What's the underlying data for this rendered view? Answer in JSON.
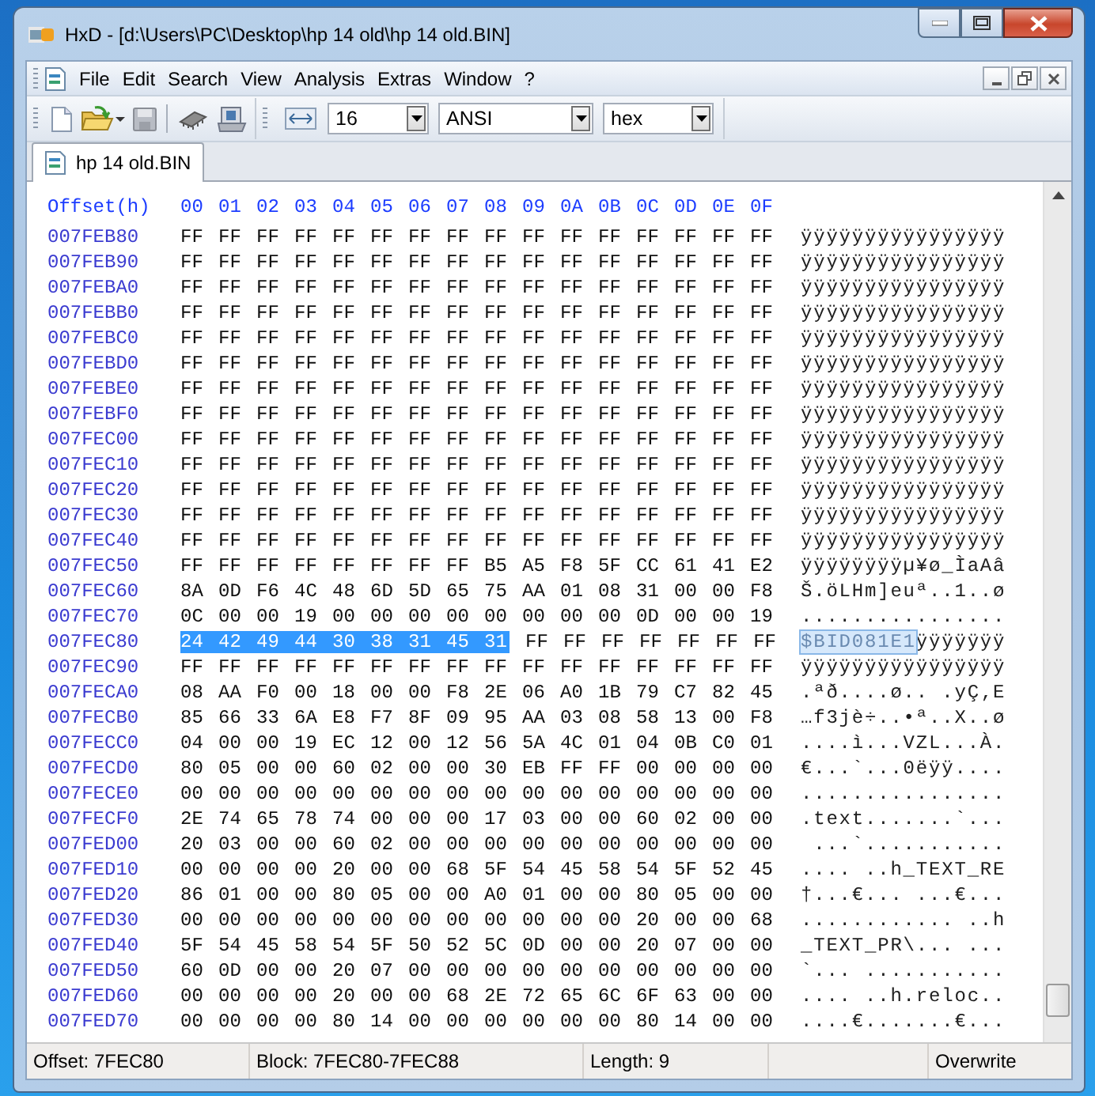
{
  "window": {
    "title": "HxD - [d:\\Users\\PC\\Desktop\\hp 14 old\\hp 14 old.BIN]"
  },
  "menu": [
    "File",
    "Edit",
    "Search",
    "View",
    "Analysis",
    "Extras",
    "Window",
    "?"
  ],
  "toolbar": {
    "bytes_per_row": "16",
    "charset": "ANSI",
    "offset_base": "hex"
  },
  "tabs": [
    {
      "label": "hp 14 old.BIN",
      "selected": true
    }
  ],
  "editor": {
    "offset_header": "Offset(h)",
    "column_headers": [
      "00",
      "01",
      "02",
      "03",
      "04",
      "05",
      "06",
      "07",
      "08",
      "09",
      "0A",
      "0B",
      "0C",
      "0D",
      "0E",
      "0F"
    ],
    "rows": [
      {
        "offset": "007FEB80",
        "hex": "FF FF FF FF FF FF FF FF FF FF FF FF FF FF FF FF",
        "text": "ÿÿÿÿÿÿÿÿÿÿÿÿÿÿÿÿ"
      },
      {
        "offset": "007FEB90",
        "hex": "FF FF FF FF FF FF FF FF FF FF FF FF FF FF FF FF",
        "text": "ÿÿÿÿÿÿÿÿÿÿÿÿÿÿÿÿ"
      },
      {
        "offset": "007FEBA0",
        "hex": "FF FF FF FF FF FF FF FF FF FF FF FF FF FF FF FF",
        "text": "ÿÿÿÿÿÿÿÿÿÿÿÿÿÿÿÿ"
      },
      {
        "offset": "007FEBB0",
        "hex": "FF FF FF FF FF FF FF FF FF FF FF FF FF FF FF FF",
        "text": "ÿÿÿÿÿÿÿÿÿÿÿÿÿÿÿÿ"
      },
      {
        "offset": "007FEBC0",
        "hex": "FF FF FF FF FF FF FF FF FF FF FF FF FF FF FF FF",
        "text": "ÿÿÿÿÿÿÿÿÿÿÿÿÿÿÿÿ"
      },
      {
        "offset": "007FEBD0",
        "hex": "FF FF FF FF FF FF FF FF FF FF FF FF FF FF FF FF",
        "text": "ÿÿÿÿÿÿÿÿÿÿÿÿÿÿÿÿ"
      },
      {
        "offset": "007FEBE0",
        "hex": "FF FF FF FF FF FF FF FF FF FF FF FF FF FF FF FF",
        "text": "ÿÿÿÿÿÿÿÿÿÿÿÿÿÿÿÿ"
      },
      {
        "offset": "007FEBF0",
        "hex": "FF FF FF FF FF FF FF FF FF FF FF FF FF FF FF FF",
        "text": "ÿÿÿÿÿÿÿÿÿÿÿÿÿÿÿÿ"
      },
      {
        "offset": "007FEC00",
        "hex": "FF FF FF FF FF FF FF FF FF FF FF FF FF FF FF FF",
        "text": "ÿÿÿÿÿÿÿÿÿÿÿÿÿÿÿÿ"
      },
      {
        "offset": "007FEC10",
        "hex": "FF FF FF FF FF FF FF FF FF FF FF FF FF FF FF FF",
        "text": "ÿÿÿÿÿÿÿÿÿÿÿÿÿÿÿÿ"
      },
      {
        "offset": "007FEC20",
        "hex": "FF FF FF FF FF FF FF FF FF FF FF FF FF FF FF FF",
        "text": "ÿÿÿÿÿÿÿÿÿÿÿÿÿÿÿÿ"
      },
      {
        "offset": "007FEC30",
        "hex": "FF FF FF FF FF FF FF FF FF FF FF FF FF FF FF FF",
        "text": "ÿÿÿÿÿÿÿÿÿÿÿÿÿÿÿÿ"
      },
      {
        "offset": "007FEC40",
        "hex": "FF FF FF FF FF FF FF FF FF FF FF FF FF FF FF FF",
        "text": "ÿÿÿÿÿÿÿÿÿÿÿÿÿÿÿÿ"
      },
      {
        "offset": "007FEC50",
        "hex": "FF FF FF FF FF FF FF FF B5 A5 F8 5F CC 61 41 E2",
        "text": "ÿÿÿÿÿÿÿÿµ¥ø_ÌaAâ"
      },
      {
        "offset": "007FEC60",
        "hex": "8A 0D F6 4C 48 6D 5D 65 75 AA 01 08 31 00 00 F8",
        "text": "Š.öLHm]euª..1..ø"
      },
      {
        "offset": "007FEC70",
        "hex": "0C 00 00 19 00 00 00 00 00 00 00 00 0D 00 00 19",
        "text": "................"
      },
      {
        "offset": "007FEC80",
        "hex_selected": "24 42 49 44 30 38 31 45 31",
        "hex": "FF FF FF FF FF FF FF",
        "text_selected": "$BID081E1",
        "text": "ÿÿÿÿÿÿÿ"
      },
      {
        "offset": "007FEC90",
        "hex": "FF FF FF FF FF FF FF FF FF FF FF FF FF FF FF FF",
        "text": "ÿÿÿÿÿÿÿÿÿÿÿÿÿÿÿÿ"
      },
      {
        "offset": "007FECA0",
        "hex": "08 AA F0 00 18 00 00 F8 2E 06 A0 1B 79 C7 82 45",
        "text": ".ªð....ø.. .yÇ‚E"
      },
      {
        "offset": "007FECB0",
        "hex": "85 66 33 6A E8 F7 8F 09 95 AA 03 08 58 13 00 F8",
        "text": "…f3jè÷..•ª..X..ø"
      },
      {
        "offset": "007FECC0",
        "hex": "04 00 00 19 EC 12 00 12 56 5A 4C 01 04 0B C0 01",
        "text": "....ì...VZL...À."
      },
      {
        "offset": "007FECD0",
        "hex": "80 05 00 00 60 02 00 00 30 EB FF FF 00 00 00 00",
        "text": "€...`...0ëÿÿ...."
      },
      {
        "offset": "007FECE0",
        "hex": "00 00 00 00 00 00 00 00 00 00 00 00 00 00 00 00",
        "text": "................"
      },
      {
        "offset": "007FECF0",
        "hex": "2E 74 65 78 74 00 00 00 17 03 00 00 60 02 00 00",
        "text": ".text.......`..."
      },
      {
        "offset": "007FED00",
        "hex": "20 03 00 00 60 02 00 00 00 00 00 00 00 00 00 00",
        "text": " ...`..........."
      },
      {
        "offset": "007FED10",
        "hex": "00 00 00 00 20 00 00 68 5F 54 45 58 54 5F 52 45",
        "text": ".... ..h_TEXT_RE"
      },
      {
        "offset": "007FED20",
        "hex": "86 01 00 00 80 05 00 00 A0 01 00 00 80 05 00 00",
        "text": "†...€... ...€..."
      },
      {
        "offset": "007FED30",
        "hex": "00 00 00 00 00 00 00 00 00 00 00 00 20 00 00 68",
        "text": "............ ..h"
      },
      {
        "offset": "007FED40",
        "hex": "5F 54 45 58 54 5F 50 52 5C 0D 00 00 20 07 00 00",
        "text": "_TEXT_PR\\... ..."
      },
      {
        "offset": "007FED50",
        "hex": "60 0D 00 00 20 07 00 00 00 00 00 00 00 00 00 00",
        "text": "`... ..........."
      },
      {
        "offset": "007FED60",
        "hex": "00 00 00 00 20 00 00 68 2E 72 65 6C 6F 63 00 00",
        "text": ".... ..h.reloc.."
      },
      {
        "offset": "007FED70",
        "hex": "00 00 00 00 80 14 00 00 00 00 00 00 80 14 00 00",
        "text": "....€.......€..."
      }
    ]
  },
  "status_bar": {
    "offset": "Offset: 7FEC80",
    "block": "Block: 7FEC80-7FEC88",
    "length": "Length: 9",
    "mode": "Overwrite"
  }
}
